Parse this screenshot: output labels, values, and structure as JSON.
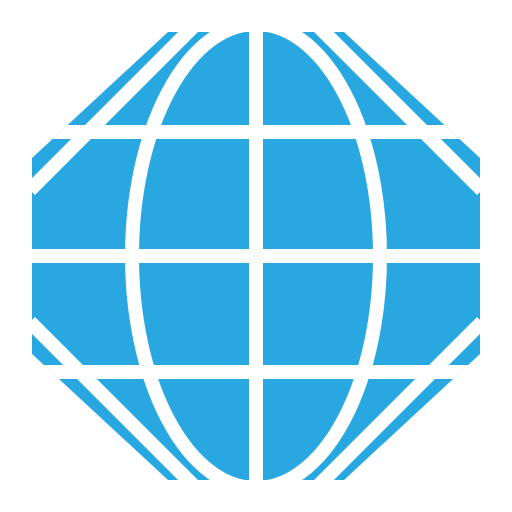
{
  "icon": {
    "name": "globe-icon",
    "fill_color": "#29A7E1",
    "line_color": "#FFFFFF",
    "background_color": "#FFFFFF"
  }
}
